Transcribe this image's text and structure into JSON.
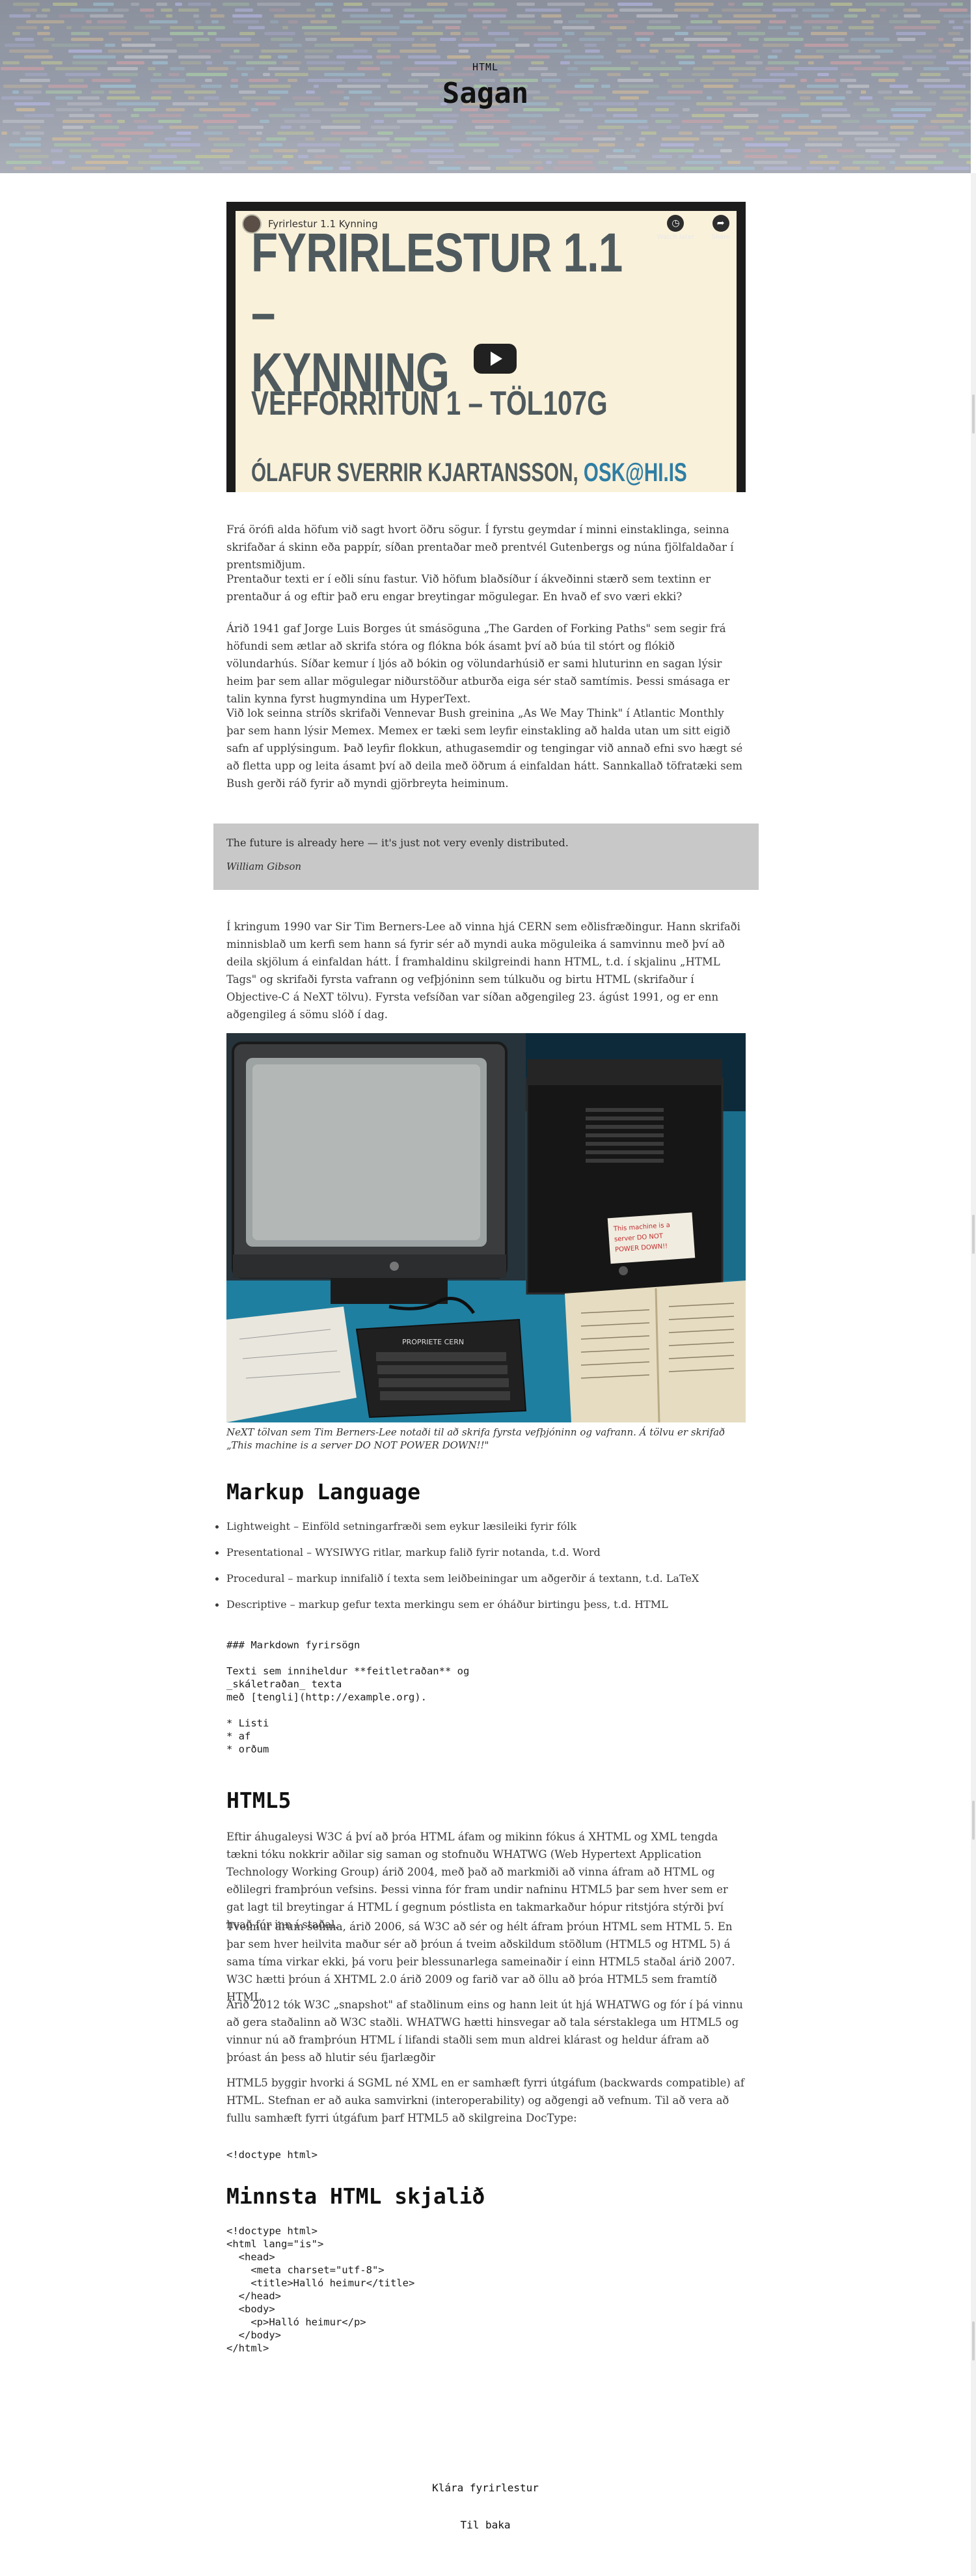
{
  "header": {
    "kicker": "HTML",
    "title": "Sagan"
  },
  "video": {
    "channel_title": "Fyrirlestur 1.1 Kynning",
    "watch_later": "Watch later",
    "share": "Share",
    "slide_line1": "FYRIRLESTUR 1.1 –",
    "slide_line2": "KYNNING",
    "slide_line3": "VEFFORRITUN 1 – TÖL107G",
    "slide_author": "ÓLAFUR SVERRIR KJARTANSSON, ",
    "slide_email": "OSK@HI.IS"
  },
  "paragraphs": {
    "p1": "Frá örófi alda höfum við sagt hvort öðru sögur. Í fyrstu geymdar í minni einstaklinga, seinna skrifaðar á skinn eða pappír, síðan prentaðar með prentvél Gutenbergs og núna fjölfaldaðar í prentsmiðjum.",
    "p2": "Prentaður texti er í eðli sínu fastur. Við höfum blaðsíður í ákveðinni stærð sem textinn er prentaður á og eftir það eru engar breytingar mögulegar. En hvað ef svo væri ekki?",
    "p3": "Árið 1941 gaf Jorge Luis Borges út smásöguna „The Garden of Forking Paths\" sem segir frá höfundi sem ætlar að skrifa stóra og flókna bók ásamt því að búa til stórt og flókið völundarhús. Síðar kemur í ljós að bókin og völundarhúsið er sami hluturinn en sagan lýsir heim þar sem allar mögulegar niðurstöður atburða eiga sér stað samtímis. Þessi smásaga er talin kynna fyrst hugmyndina um HyperText.",
    "p4": "Við lok seinna stríðs skrifaði Vennevar Bush greinina „As We May Think\" í Atlantic Monthly þar sem hann lýsir Memex. Memex er tæki sem leyfir einstakling að halda utan um sitt eigið safn af upplýsingum. Það leyfir flokkun, athugasemdir og tengingar við annað efni svo hægt sé að fletta upp og leita ásamt því að deila með öðrum á einfaldan hátt. Sannkallað töfratæki sem Bush gerði ráð fyrir að myndi gjörbreyta heiminum.",
    "p5": "Í kringum 1990 var Sir Tim Berners-Lee að vinna hjá CERN sem eðlisfræðingur. Hann skrifaði minnisblað um kerfi sem hann sá fyrir sér að myndi auka möguleika á samvinnu með því að deila skjölum á einfaldan hátt. Í framhaldinu skilgreindi hann HTML, t.d. í skjalinu „HTML Tags\" og skrifaði fyrsta vafrann og vefþjóninn sem túlkuðu og birtu HTML (skrifaður í Objective-C á NeXT tölvu). Fyrsta vefsíðan var síðan aðgengileg 23. ágúst 1991, og er enn aðgengileg á sömu slóð í dag.",
    "p6": "Eftir áhugaleysi W3C á því að þróa HTML áfam og mikinn fókus á XHTML og XML tengda tækni tóku nokkrir aðilar sig saman og stofnuðu WHATWG (Web Hypertext Application Technology Working Group) árið 2004, með það að markmiði að vinna áfram að HTML og eðlilegri framþróun vefsins. Þessi vinna fór fram undir nafninu HTML5 þar sem hver sem er gat lagt til breytingar á HTML í gegnum póstlista en takmarkaður hópur ritstjóra stýrði því hvað fór inn í staðal.",
    "p7": "Tveimur árum seinna, árið 2006, sá W3C að sér og hélt áfram þróun HTML sem HTML 5. En þar sem hver heilvita maður sér að þróun á tveim aðskildum stöðlum (HTML5 og HTML 5) á sama tíma virkar ekki, þá voru þeir blessunarlega sameinaðir í einn HTML5 staðal árið 2007. W3C hætti þróun á XHTML 2.0 árið 2009 og farið var að öllu að þróa HTML5 sem framtíð HTML.",
    "p8": "Árið 2012 tók W3C „snapshot\" af staðlinum eins og hann leit út hjá WHATWG og fór í þá vinnu að gera staðalinn að W3C staðli. WHATWG hætti hinsvegar að tala sérstaklega um HTML5 og vinnur nú að framþróun HTML í lifandi staðli sem mun aldrei klárast og heldur áfram að þróast án þess að hlutir séu fjarlægðir",
    "p9": "HTML5 byggir hvorki á SGML né XML en er samhæft fyrri útgáfum (backwards compatible) af HTML. Stefnan er að auka samvirkni (interoperability) og aðgengi að vefnum. Til að vera að fullu samhæft fyrri útgáfum þarf HTML5 að skilgreina DocType:"
  },
  "quote": {
    "text": "The future is already here — it's just not very evenly distributed.",
    "author": "William Gibson"
  },
  "photo": {
    "sticker_text": "This machine is a server DO NOT POWER DOWN!!",
    "keyboard_label": "PROPRIETE CERN",
    "caption": "NeXT tölvan sem Tim Berners-Lee notaði til að skrifa fyrsta vefþjóninn og vafrann. Á tölvu er skrifað „This machine is a server DO NOT POWER DOWN!!\""
  },
  "markup": {
    "heading": "Markup Language",
    "items": [
      "Lightweight – Einföld setningarfræði sem eykur læsileiki fyrir fólk",
      "Presentational – WYSIWYG ritlar, markup falið fyrir notanda, t.d. Word",
      "Procedural – markup innifalið í texta sem leiðbeiningar um aðgerðir á textann, t.d. LaTeX",
      "Descriptive – markup gefur texta merkingu sem er óháður birtingu þess, t.d. HTML"
    ],
    "markdown_code": "### Markdown fyrirsögn\n\nTexti sem inniheldur **feitletraðan** og\n_skáletraðan_ texta\nmeð [tengli](http://example.org).\n\n* Listi\n* af\n* orðum"
  },
  "html5": {
    "heading": "HTML5",
    "doctype_code": "<!doctype html>"
  },
  "minimal": {
    "heading": "Minnsta HTML skjalið",
    "code": "<!doctype html>\n<html lang=\"is\">\n  <head>\n    <meta charset=\"utf-8\">\n    <title>Halló heimur</title>\n  </head>\n  <body>\n    <p>Halló heimur</p>\n  </body>\n</html>"
  },
  "footer": {
    "finish_link": "Klára fyrirlestur",
    "back_link": "Til baka"
  },
  "colors": {
    "quote_bg": "#c8c8c8",
    "email_blue": "#2f7ea4",
    "slide_bg": "#faf1da"
  }
}
